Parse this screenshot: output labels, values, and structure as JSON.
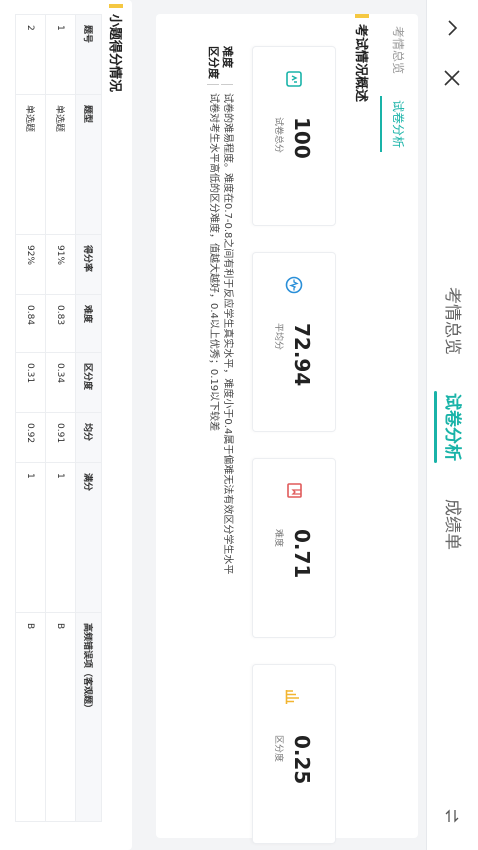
{
  "topbar": {
    "tabs": [
      {
        "label": "考情总览"
      },
      {
        "label": "试卷分析"
      },
      {
        "label": "成绩单"
      }
    ],
    "active_index": 1
  },
  "overview": {
    "inner_tabs": [
      {
        "label": "考情总览"
      },
      {
        "label": "试卷分析"
      }
    ],
    "section_title": "考试情况概述",
    "stats": [
      {
        "value": "100",
        "label": "试卷总分",
        "icon": "doc-icon",
        "color": "#19b3a8"
      },
      {
        "value": "72.94",
        "label": "平均分",
        "icon": "pulse-icon",
        "color": "#2a8fd8"
      },
      {
        "value": "0.71",
        "label": "难度",
        "icon": "book-icon",
        "color": "#e05a5a"
      },
      {
        "value": "0.25",
        "label": "区分度",
        "icon": "bars-icon",
        "color": "#f2b531"
      }
    ],
    "desc": [
      {
        "key": "难度",
        "text": "试卷的难易程度。难度在0.7-0.8之间有利于反应学生真实水平，难度小于0.4属于偏难无法有效区分学生水平"
      },
      {
        "key": "区分度",
        "text": "试卷对考生水平高低的区分难度，值越大越好，0.4以上优秀；0.19以下较差"
      }
    ]
  },
  "items": {
    "section_title": "小题得分情况",
    "headers": [
      "题号",
      "题型",
      "得分率",
      "难度",
      "区分度",
      "均分",
      "满分",
      "高频错误项（客观题）"
    ],
    "rows": [
      [
        "1",
        "单选题",
        "91%",
        "0.83",
        "0.34",
        "0.91",
        "1",
        "B"
      ],
      [
        "2",
        "单选题",
        "92%",
        "0.84",
        "0.31",
        "0.92",
        "1",
        "B"
      ]
    ]
  }
}
